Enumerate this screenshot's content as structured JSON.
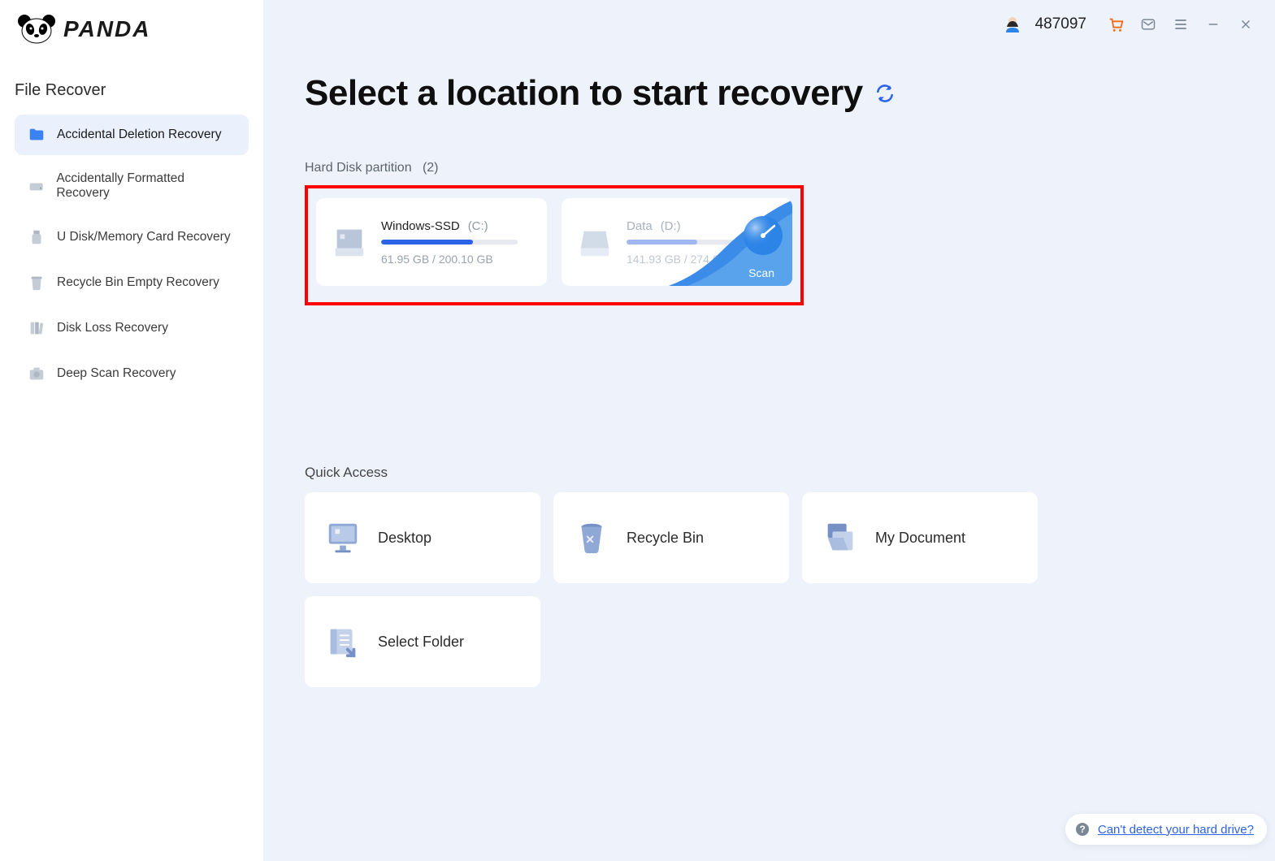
{
  "brand": "PANDA",
  "sidebar": {
    "title": "File Recover",
    "items": [
      {
        "label": "Accidental Deletion Recovery",
        "icon": "folder-icon",
        "active": true
      },
      {
        "label": "Accidentally Formatted Recovery",
        "icon": "hdd-icon",
        "active": false
      },
      {
        "label": "U Disk/Memory Card Recovery",
        "icon": "usb-icon",
        "active": false
      },
      {
        "label": "Recycle Bin Empty Recovery",
        "icon": "bin-icon",
        "active": false
      },
      {
        "label": "Disk Loss Recovery",
        "icon": "books-icon",
        "active": false
      },
      {
        "label": "Deep Scan Recovery",
        "icon": "camera-icon",
        "active": false
      }
    ]
  },
  "topbar": {
    "user_id": "487097"
  },
  "main": {
    "headline": "Select a location to start recovery",
    "partition_label": "Hard Disk partition",
    "partition_count": "(2)",
    "drives": [
      {
        "name": "Windows-SSD",
        "letter": "(C:)",
        "usage": "61.95 GB / 200.10 GB",
        "fill_pct": 67,
        "hover": false
      },
      {
        "name": "Data",
        "letter": "(D:)",
        "usage": "141.93 GB / 274.62 GB",
        "fill_pct": 52,
        "hover": true,
        "scan_label": "Scan"
      }
    ],
    "quick_label": "Quick Access",
    "quick": [
      {
        "label": "Desktop",
        "icon": "desktop-icon"
      },
      {
        "label": "Recycle Bin",
        "icon": "recycle-bin-icon"
      },
      {
        "label": "My Document",
        "icon": "document-icon"
      },
      {
        "label": "Select Folder",
        "icon": "select-folder-icon"
      }
    ],
    "help_text": "Can't detect your hard drive?"
  }
}
